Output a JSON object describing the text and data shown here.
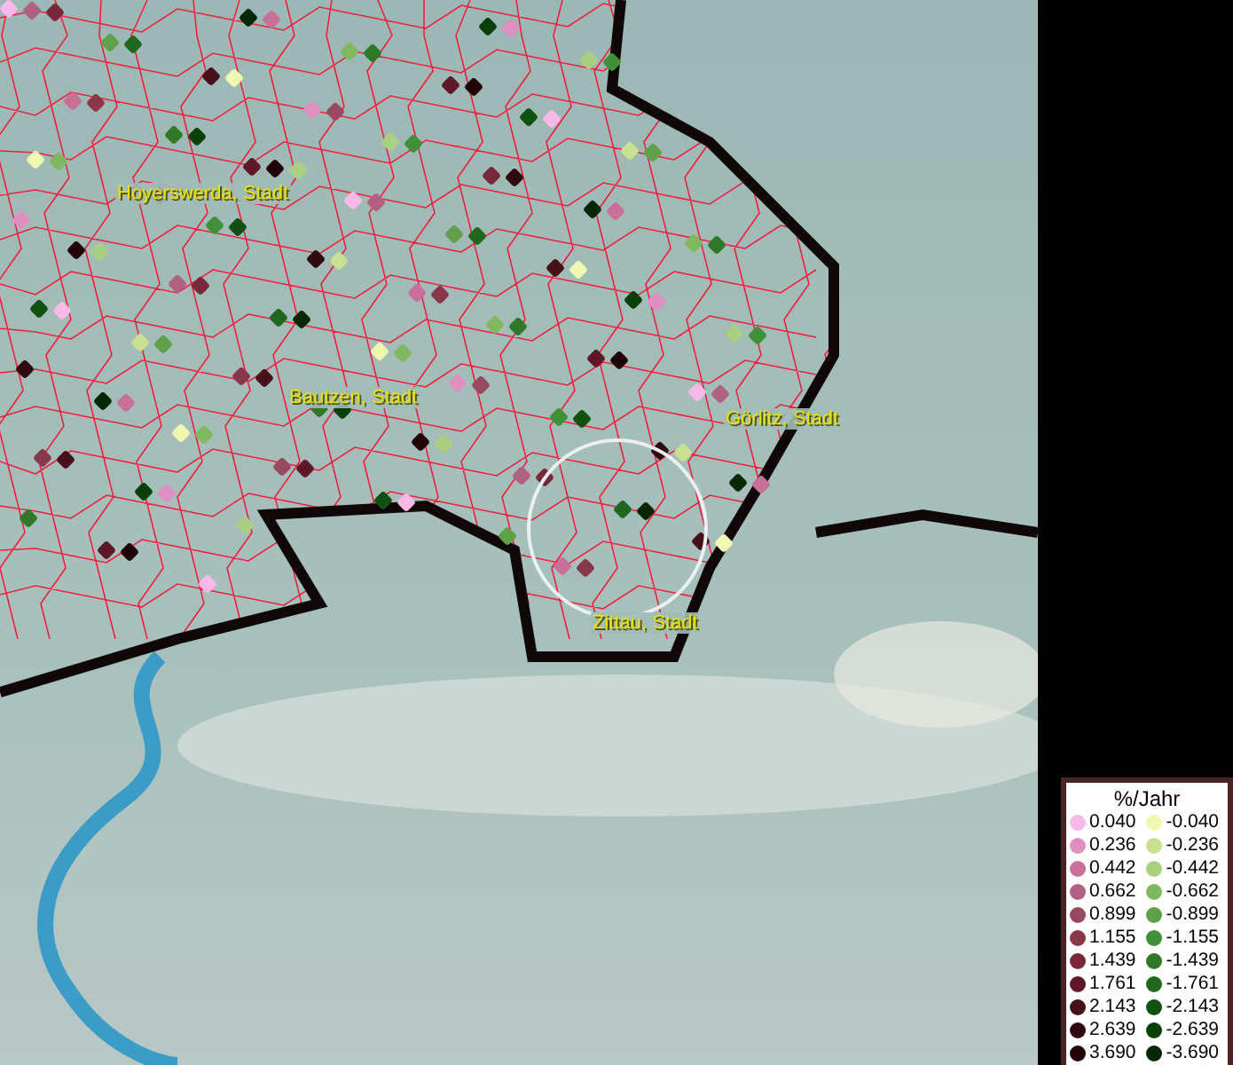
{
  "map": {
    "places": [
      {
        "name": "Hoyerswerda, Stadt"
      },
      {
        "name": "Bautzen, Stadt"
      },
      {
        "name": "Görlitz, Stadt"
      },
      {
        "name": "Zittau, Stadt"
      }
    ]
  },
  "legend": {
    "title": "%/Jahr",
    "positive": [
      {
        "label": "0.040",
        "color": "#f8b8e8"
      },
      {
        "label": "0.236",
        "color": "#e090c0"
      },
      {
        "label": "0.442",
        "color": "#c87098"
      },
      {
        "label": "0.662",
        "color": "#b06080"
      },
      {
        "label": "0.899",
        "color": "#984860"
      },
      {
        "label": "1.155",
        "color": "#883848"
      },
      {
        "label": "1.439",
        "color": "#782838"
      },
      {
        "label": "1.761",
        "color": "#601828"
      },
      {
        "label": "2.143",
        "color": "#481018"
      },
      {
        "label": "2.639",
        "color": "#300810"
      },
      {
        "label": "3.690",
        "color": "#200408"
      }
    ],
    "negative": [
      {
        "label": "-0.040",
        "color": "#f0f8b0"
      },
      {
        "label": "-0.236",
        "color": "#c8e090"
      },
      {
        "label": "-0.442",
        "color": "#a8d080"
      },
      {
        "label": "-0.662",
        "color": "#80b860"
      },
      {
        "label": "-0.899",
        "color": "#60a048"
      },
      {
        "label": "-1.155",
        "color": "#409038"
      },
      {
        "label": "-1.439",
        "color": "#307828"
      },
      {
        "label": "-1.761",
        "color": "#206820"
      },
      {
        "label": "-2.143",
        "color": "#105010"
      },
      {
        "label": "-2.639",
        "color": "#084008"
      },
      {
        "label": "-3.690",
        "color": "#042804"
      }
    ]
  }
}
